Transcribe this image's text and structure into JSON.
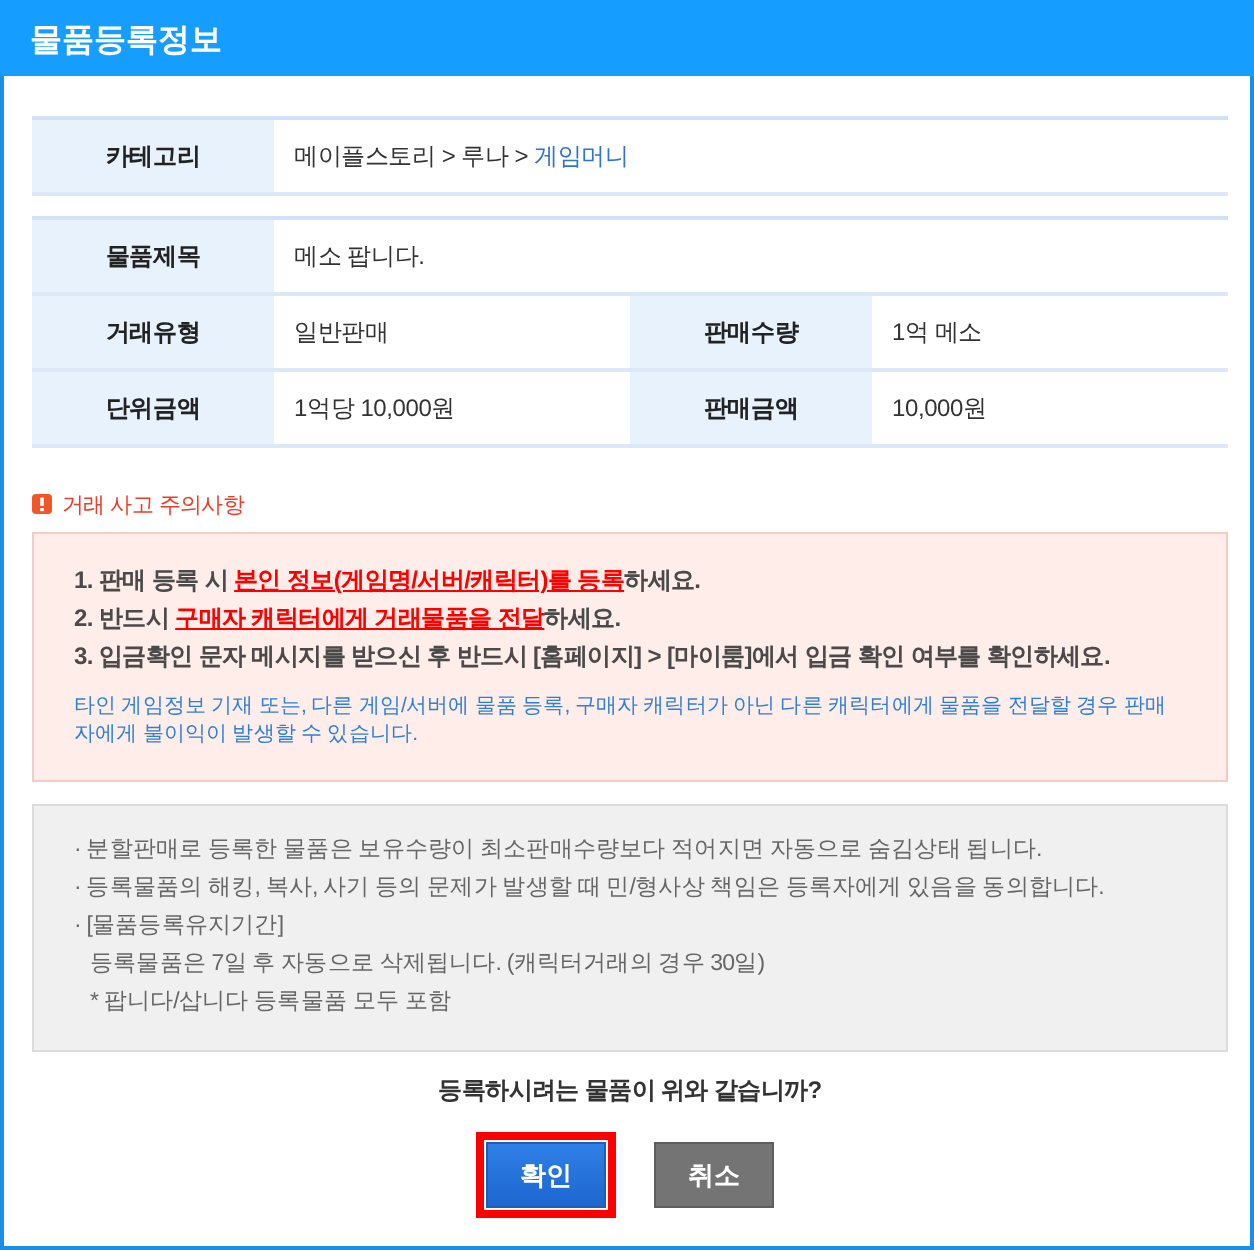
{
  "window": {
    "title": "물품등록정보"
  },
  "category": {
    "label": "카테고리",
    "path": [
      {
        "text": "메이플스토리",
        "current": false
      },
      {
        "text": "루나",
        "current": false
      },
      {
        "text": "게임머니",
        "current": true
      }
    ],
    "separators": [
      ">",
      ">"
    ]
  },
  "details": {
    "rows": [
      {
        "cells": [
          {
            "label": "물품제목",
            "value": "메소 팝니다."
          }
        ]
      },
      {
        "cells": [
          {
            "label": "거래유형",
            "value": "일반판매"
          },
          {
            "label": "판매수량",
            "value": "1억 메소"
          }
        ]
      },
      {
        "cells": [
          {
            "label": "단위금액",
            "value": "1억당 10,000원"
          },
          {
            "label": "판매금액",
            "value": "10,000원"
          }
        ]
      }
    ]
  },
  "caution": {
    "title": "거래 사고 주의사항",
    "items": [
      "1. 판매 등록 시 **본인 정보(게임명/서버/캐릭터)를 등록**하세요.",
      "2. 반드시 **구매자 캐릭터에게 거래물품을 전달**하세요.",
      "3. 입금확인 문자 메시지를 받으신 후 반드시 [홈페이지] > [마이룸]에서 입금 확인 여부를 확인하세요."
    ],
    "note": "타인 게임정보 기재 또는, 다른 게임/서버에 물품 등록, 구매자 캐릭터가 아닌 다른 캐릭터에게 물품을 전달할 경우 판매자에게 불이익이 발생할 수 있습니다."
  },
  "notice": {
    "items": [
      {
        "text": "· 분할판매로 등록한 물품은 보유수량이 최소판매수량보다 적어지면 자동으로 숨김상태 됩니다."
      },
      {
        "text": "· 등록물품의 해킹, 복사, 사기 등의 문제가 발생할 때 민/형사상 책임은 등록자에게 있음을 동의합니다."
      },
      {
        "text": "· [물품등록유지기간]",
        "children": [
          {
            "text": "등록물품은 7일 후 자동으로 삭제됩니다. (캐릭터거래의 경우 30일)"
          },
          {
            "text": "* 팝니다/삽니다 등록물품 모두 포함"
          }
        ]
      }
    ]
  },
  "confirm": {
    "question": "등록하시려는 물품이 위와 같습니까?",
    "buttons": [
      {
        "label": "확인",
        "kind": "primary",
        "highlighted": true
      },
      {
        "label": "취소",
        "kind": "secondary",
        "highlighted": false
      }
    ]
  }
}
